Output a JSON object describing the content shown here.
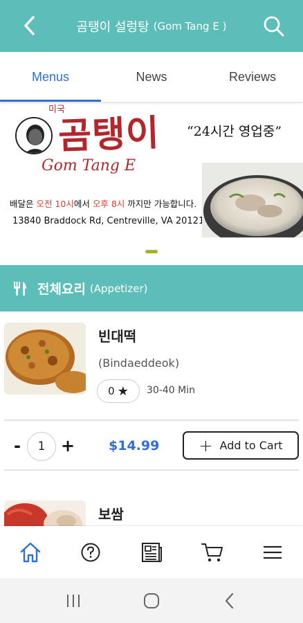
{
  "header": {
    "title_ko": "곰탱이 설렁탕",
    "title_en": "(Gom Tang E )",
    "back_icon": "chevron-left-icon",
    "search_icon": "search-icon"
  },
  "tabs": [
    {
      "label": "Menus",
      "active": true
    },
    {
      "label": "News",
      "active": false
    },
    {
      "label": "Reviews",
      "active": false
    }
  ],
  "banner": {
    "brand_top": "미국",
    "brand_ko": "곰탱이",
    "brand_en": "Gom Tang E",
    "hours": "“24시간 영업중”",
    "delivery_prefix": "배달은 ",
    "delivery_start": "오전 10시",
    "delivery_mid": "에서 ",
    "delivery_end": "오후 8시",
    "delivery_suffix": " 까지만 가능합니다.",
    "address": "13840 Braddock Rd, Centreville, VA 20121",
    "carousel_pages": 1,
    "carousel_active": 1
  },
  "category": {
    "icon": "utensils-icon",
    "title_ko": "전체요리",
    "title_en": "(Appetizer)"
  },
  "items": [
    {
      "name": "빈대떡",
      "romanized": "(Bindaeddeok)",
      "rating": "0",
      "prep_time": "30-40 Min",
      "quantity": "1",
      "price": "$14.99",
      "add_label": "Add to Cart"
    },
    {
      "name": "보쌈"
    }
  ],
  "bottom_nav": [
    {
      "icon": "home-icon",
      "active": true
    },
    {
      "icon": "help-icon",
      "active": false
    },
    {
      "icon": "newspaper-icon",
      "active": false
    },
    {
      "icon": "cart-icon",
      "active": false
    },
    {
      "icon": "menu-icon",
      "active": false
    }
  ],
  "system_nav": [
    "recents-icon",
    "home-circle-icon",
    "back-icon"
  ],
  "colors": {
    "primary": "#5dbdb8",
    "accent_blue": "#2f6fd6",
    "brand_red": "#b3262b",
    "carousel_dot": "#9ab82a"
  }
}
